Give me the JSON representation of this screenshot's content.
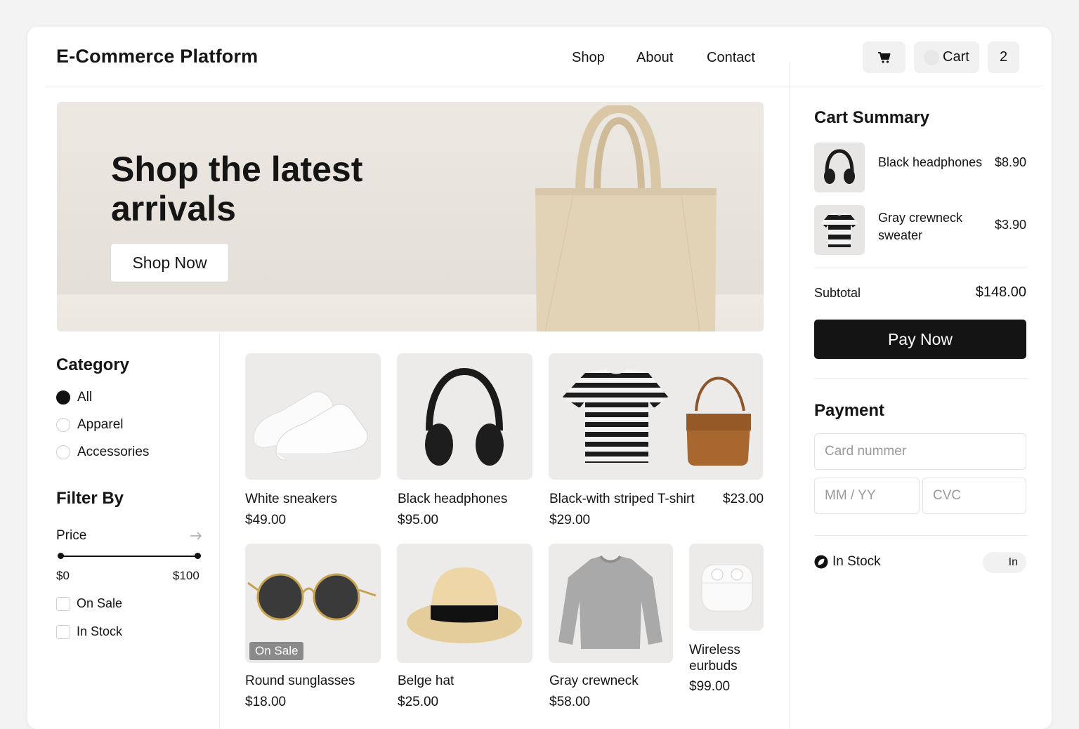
{
  "header": {
    "brand": "E-Commerce Platform",
    "nav": [
      {
        "label": "Shop"
      },
      {
        "label": "About"
      },
      {
        "label": "Contact"
      }
    ],
    "cart_label": "Cart",
    "cart_count": "2"
  },
  "hero": {
    "title": "Shop the latest arrivals",
    "button": "Shop Now"
  },
  "sidebar": {
    "category_title": "Category",
    "categories": [
      {
        "label": "All",
        "selected": true
      },
      {
        "label": "Apparel",
        "selected": false
      },
      {
        "label": "Accessories",
        "selected": false
      }
    ],
    "filter_title": "Filter By",
    "price_label": "Price",
    "price_min": "$0",
    "price_max": "$100",
    "checkboxes": [
      {
        "label": "On Sale",
        "checked": false
      },
      {
        "label": "In Stock",
        "checked": false
      }
    ]
  },
  "products": [
    {
      "name": "White sneakers",
      "price": "$49.00"
    },
    {
      "name": "Black headphones",
      "price": "$95.00"
    },
    {
      "name": "Black-with striped T-shirt",
      "price": "$29.00",
      "extra_price": "$23.00"
    },
    {
      "name": "Round sunglasses",
      "price": "$18.00",
      "badge": "On Sale"
    },
    {
      "name": "Belge hat",
      "price": "$25.00"
    },
    {
      "name": "Gray crewneck",
      "price": "$58.00"
    },
    {
      "name": "Wireless eurbuds",
      "price": "$99.00"
    }
  ],
  "cart_summary": {
    "title": "Cart Summary",
    "items": [
      {
        "name": "Black headphones",
        "price": "$8.90"
      },
      {
        "name": "Gray crewneck sweater",
        "price": "$3.90"
      }
    ],
    "subtotal_label": "Subtotal",
    "subtotal_value": "$148.00",
    "pay_button": "Pay Now"
  },
  "payment": {
    "title": "Payment",
    "card_placeholder": "Card nummer",
    "expiry_placeholder": "MM / YY",
    "cvc_placeholder": "CVC",
    "in_stock_label": "In Stock",
    "toggle_label": "In"
  },
  "icons": {
    "cart": "shopping-cart-icon",
    "price_arrow": "arrow-right-icon",
    "in_stock": "leaf-icon"
  }
}
